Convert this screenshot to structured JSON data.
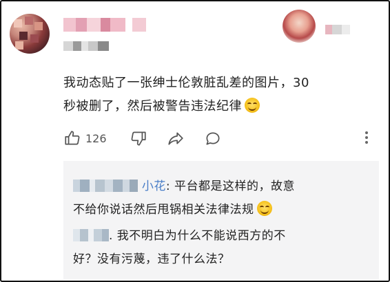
{
  "comment": {
    "text_line1": "我动态贴了一张绅士伦敦脏乱差的图片，30",
    "text_line2": "秒被删了，然后被警告违法纪律",
    "like_count": "126"
  },
  "replies": [
    {
      "author": "小花",
      "line1": ": 平台都是这样的，故意",
      "line2": "不给你说话然后甩锅相关法律法规"
    },
    {
      "author_suffix": ".",
      "line1": " 我不明白为什么不能说西方的不",
      "line2": "好？没有污蔑，违了什么法？"
    }
  ],
  "colors": {
    "link": "#4a7ec7",
    "reply_bg": "#f4f4f5"
  },
  "icons": [
    "thumbs-up-icon",
    "thumbs-down-icon",
    "share-icon",
    "comment-icon",
    "more-vert-icon",
    "grin-emoji"
  ]
}
